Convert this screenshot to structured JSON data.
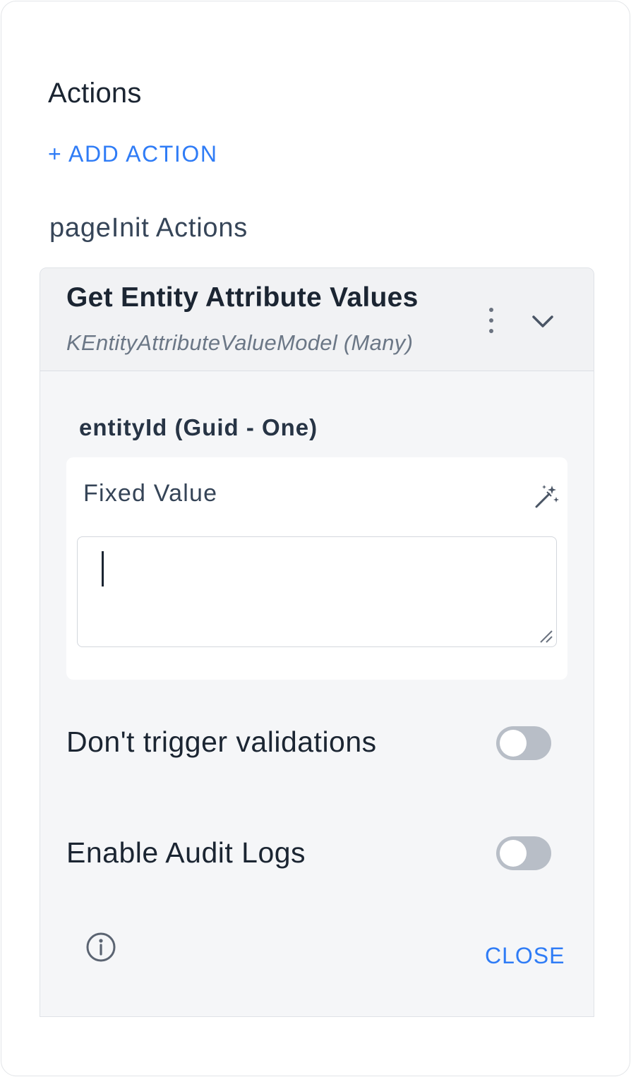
{
  "section": {
    "title": "Actions",
    "add_action_label": "+ ADD ACTION"
  },
  "group": {
    "label": "pageInit Actions"
  },
  "action_card": {
    "title": "Get Entity Attribute Values",
    "subtitle": "KEntityAttributeValueModel (Many)",
    "parameter": {
      "label": "entityId (Guid - One)",
      "value_type": "Fixed Value",
      "value": ""
    },
    "toggles": [
      {
        "label": "Don't trigger validations",
        "on": false
      },
      {
        "label": "Enable Audit Logs",
        "on": false
      }
    ],
    "close_label": "CLOSE"
  },
  "colors": {
    "accent": "#2f7cf6",
    "text_primary": "#1b2532",
    "toggle_off": "#b8bec7",
    "card_bg": "#f5f6f8"
  },
  "icons": {
    "menu": "kebab-menu-icon",
    "expand": "chevron-down-icon",
    "magic": "magic-wand-icon",
    "info": "info-icon",
    "resize": "resize-handle-icon"
  }
}
